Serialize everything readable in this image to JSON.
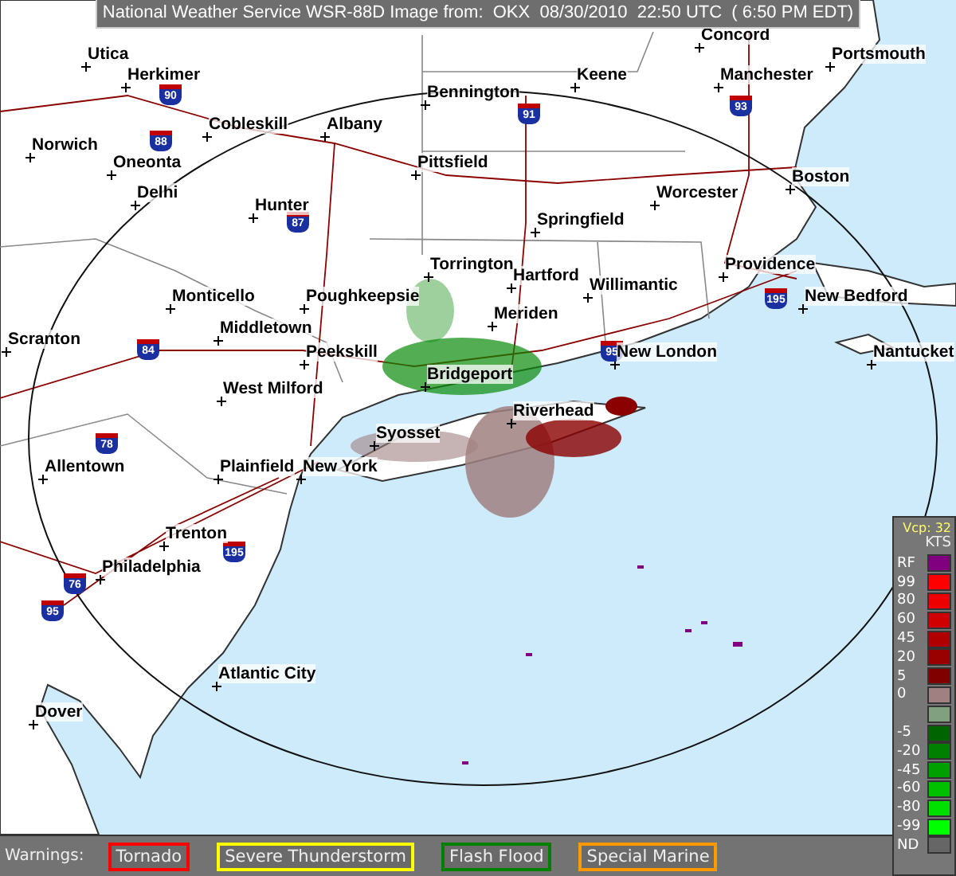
{
  "title_bar": {
    "text": "National Weather Service WSR-88D Image from:  OKX  08/30/2010  22:50 UTC  ( 6:50 PM EDT)"
  },
  "map": {
    "cities": [
      {
        "name": "Concord"
      },
      {
        "name": "Utica"
      },
      {
        "name": "Portsmouth"
      },
      {
        "name": "Herkimer"
      },
      {
        "name": "Keene"
      },
      {
        "name": "Manchester"
      },
      {
        "name": "Bennington"
      },
      {
        "name": "Cobleskill"
      },
      {
        "name": "Albany"
      },
      {
        "name": "Norwich"
      },
      {
        "name": "Oneonta"
      },
      {
        "name": "Pittsfield"
      },
      {
        "name": "Boston"
      },
      {
        "name": "Delhi"
      },
      {
        "name": "Worcester"
      },
      {
        "name": "Hunter"
      },
      {
        "name": "Springfield"
      },
      {
        "name": "Torrington"
      },
      {
        "name": "Providence"
      },
      {
        "name": "Hartford"
      },
      {
        "name": "Willimantic"
      },
      {
        "name": "Monticello"
      },
      {
        "name": "Poughkeepsie"
      },
      {
        "name": "New Bedford"
      },
      {
        "name": "Meriden"
      },
      {
        "name": "Middletown"
      },
      {
        "name": "Scranton"
      },
      {
        "name": "Peekskill"
      },
      {
        "name": "New London"
      },
      {
        "name": "Nantucket"
      },
      {
        "name": "Bridgeport"
      },
      {
        "name": "West Milford"
      },
      {
        "name": "Riverhead"
      },
      {
        "name": "Syosset"
      },
      {
        "name": "Allentown"
      },
      {
        "name": "Plainfield"
      },
      {
        "name": "New York"
      },
      {
        "name": "Trenton"
      },
      {
        "name": "Philadelphia"
      },
      {
        "name": "Atlantic City"
      },
      {
        "name": "Dover"
      }
    ],
    "shields": [
      {
        "number": "90"
      },
      {
        "number": "88"
      },
      {
        "number": "87"
      },
      {
        "number": "91"
      },
      {
        "number": "93"
      },
      {
        "number": "84"
      },
      {
        "number": "95"
      },
      {
        "number": "195"
      },
      {
        "number": "78"
      },
      {
        "number": "195"
      },
      {
        "number": "76"
      },
      {
        "number": "95"
      }
    ]
  },
  "legend": {
    "vcp": "Vcp: 32",
    "units": "KTS",
    "entries": [
      {
        "label": "RF",
        "color": "#800080"
      },
      {
        "label": "99",
        "color": "#ff0000"
      },
      {
        "label": "80",
        "color": "#ee0000"
      },
      {
        "label": "60",
        "color": "#d00000"
      },
      {
        "label": "45",
        "color": "#b00000"
      },
      {
        "label": "20",
        "color": "#990000"
      },
      {
        "label": "5",
        "color": "#800000"
      },
      {
        "label": "0",
        "color": "#a08080"
      },
      {
        "color": "#80a080"
      },
      {
        "label": "-5",
        "color": "#006400"
      },
      {
        "label": "-20",
        "color": "#008000"
      },
      {
        "label": "-45",
        "color": "#00a000"
      },
      {
        "label": "-60",
        "color": "#00c000"
      },
      {
        "label": "-80",
        "color": "#00e000"
      },
      {
        "label": "-99",
        "color": "#00ff00"
      },
      {
        "label": "ND",
        "color": "#666666"
      }
    ]
  },
  "warnings": {
    "label": "Warnings:",
    "items": [
      {
        "text": "Tornado",
        "color": "#ff0000"
      },
      {
        "text": "Severe Thunderstorm",
        "color": "#ffff00"
      },
      {
        "text": "Flash Flood",
        "color": "#008000"
      },
      {
        "text": "Special Marine",
        "color": "#ff9900"
      }
    ]
  }
}
